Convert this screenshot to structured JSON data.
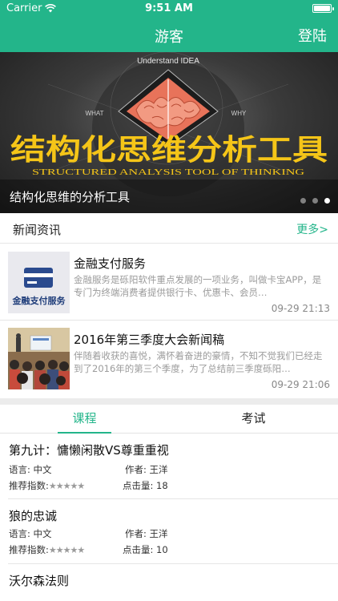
{
  "status_bar": {
    "carrier": "Carrier",
    "time": "9:51 AM",
    "battery_level": 1.0
  },
  "nav": {
    "title": "游客",
    "login_label": "登陆"
  },
  "banner": {
    "graphic_text_top": "Understand IDEA",
    "graphic_text_left": "WHAT",
    "graphic_text_right": "WHY",
    "graphic_headline": "结构化思维分析工具",
    "graphic_subline": "STRUCTURED ANALYSIS TOOL OF THINKING",
    "caption": "结构化思维的分析工具",
    "slide_count": 3,
    "active_slide": 3
  },
  "news": {
    "section_title": "新闻资讯",
    "more_label": "更多>",
    "items": [
      {
        "title": "金融支付服务",
        "thumb_label": "金融支付服务",
        "description": "金融服务是砾阳软件重点发展的一项业务，叫做卡宝APP，是专门为终端消费者提供银行卡、优惠卡、会员…",
        "time": "09-29 21:13"
      },
      {
        "title": "2016年第三季度大会新闻稿",
        "description": "伴随着收获的喜悦，满怀着奋进的豪情，不知不觉我们已经走到了2016年的第三个季度，为了总结前三季度砾阳…",
        "time": "09-29 21:06"
      }
    ]
  },
  "tabs": {
    "course_label": "课程",
    "exam_label": "考试",
    "active": "课程"
  },
  "courses": [
    {
      "title": "第九计：慵懒闲散VS尊重重视",
      "language_label": "语言:",
      "language": "中文",
      "author_label": "作者:",
      "author": "王洋",
      "rating_label": "推荐指数:",
      "rating": 5,
      "stars": "★★★★★",
      "clicks_label": "点击量:",
      "clicks": "18"
    },
    {
      "title": "狼的忠诚",
      "language_label": "语言:",
      "language": "中文",
      "author_label": "作者:",
      "author": "王洋",
      "rating_label": "推荐指数:",
      "rating": 5,
      "stars": "★★★★★",
      "clicks_label": "点击量:",
      "clicks": "10"
    },
    {
      "title": "沃尔森法则"
    }
  ],
  "colors": {
    "accent": "#23b58a",
    "banner_text": "#f5c518",
    "divider": "#e6e6e6"
  }
}
